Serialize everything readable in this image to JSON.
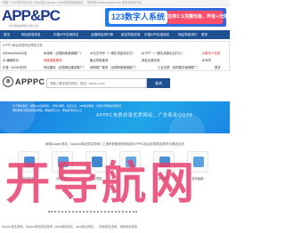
{
  "top_notice": "说明：2023年5月15日 平台已经从appgc.com迁移到此新域名，了解详情 www.apppc.com 更多资讯请关注",
  "logo": {
    "text": "APP&PC",
    "subtitle": "中文网站的网址分类大全"
  },
  "banner": {
    "pill": "123数字人系统",
    "pitch": "支持1:1克隆形象、声音+无限多开"
  },
  "nav": {
    "items": [
      "首页",
      "网址收录排名",
      "中国APP应用排名",
      "全国网址排行榜",
      "新站导航收录",
      "中国APP应用排名",
      "网站导航排行",
      "网址收录排名",
      "更多"
    ]
  },
  "categories": {
    "title": "APPPC网址收录网址导航分类",
    "items": [
      "AIDeepSeek大全",
      "私域网（全国网络营销推广）",
      "AI论文写作（一键生成高效论文）",
      "AI PPT（一键生成演示幻灯片）",
      "AI数字人系统",
      "AI 编程助手",
      "深度搜索推荐",
      "聚合导航推荐",
      "网址目录收录",
      "AI写作",
      "抖音（SAAS系列）",
      "网站建设（全国网站建设推广）",
      "网络推广服务（全国网络营销推广）",
      "工业互联（全网整合营销推广）",
      "更多"
    ]
  },
  "search": {
    "logo_mark": "a",
    "logo_word": "APPPC",
    "placeholder": "请输入要查找的网站，例如：baidu.com",
    "button": "查询"
  },
  "hero": {
    "ad_text": "APPPC免费收录优质网站，广告联系QQ38",
    "line1": "关于网址收录：中国app应用排名，全网ai导航，站长之家，APP站长推荐，有效宣传网站免费收录",
    "line2": "网站导航分类目录收录网站，网站收录大全，网站收录提交入口"
  },
  "intro": "使用Apppc排名（Apppc网站排名查询）工具来获取您的网站在APPPC站点收录排名情况与网站交流",
  "features": [
    "网站排名",
    "收录查询",
    "网站导航",
    "收录提交",
    "优化推广",
    "变化幅度"
  ],
  "watermark": "开导航网",
  "footer": "Apppc排名查询，Apppc网站排名查询（App网站排名，App综合排名），网站排名查询，网站综合排名"
}
